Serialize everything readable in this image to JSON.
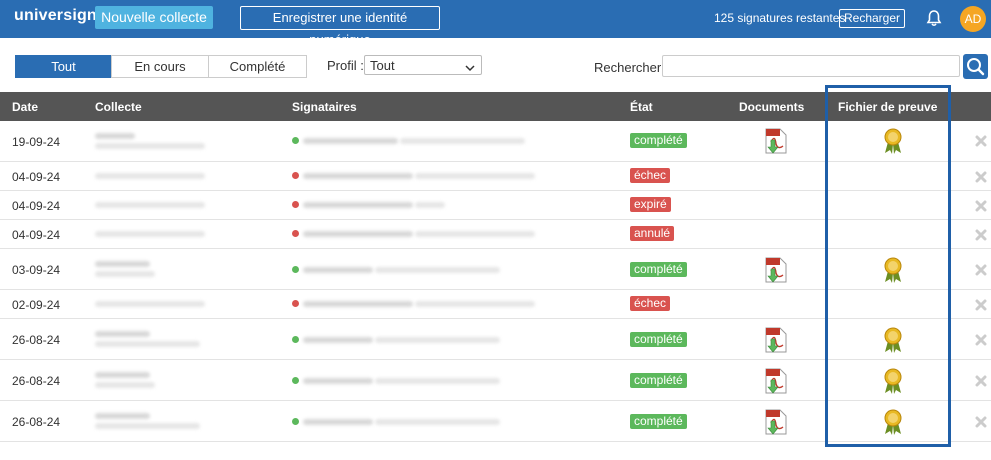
{
  "header": {
    "logo_text": "universign",
    "new_collect_label": "Nouvelle collecte",
    "register_id_label": "Enregistrer une identité numérique",
    "remaining_signatures": "125 signatures restantes",
    "recharge_label": "Recharger",
    "avatar_initials": "AD"
  },
  "filters": {
    "tabs": [
      "Tout",
      "En cours",
      "Complété"
    ],
    "active_tab": "Tout",
    "profil_label": "Profil :",
    "profil_value": "Tout",
    "search_label": "Rechercher :",
    "search_value": ""
  },
  "table": {
    "columns": [
      "Date",
      "Collecte",
      "Signataires",
      "État",
      "Documents",
      "Fichier de preuve"
    ],
    "rows": [
      {
        "date": "19-09-24",
        "state": "complété",
        "signer_status": "ok",
        "document": true,
        "proof": true
      },
      {
        "date": "04-09-24",
        "state": "échec",
        "signer_status": "err",
        "document": false,
        "proof": false
      },
      {
        "date": "04-09-24",
        "state": "expiré",
        "signer_status": "err",
        "document": false,
        "proof": false
      },
      {
        "date": "04-09-24",
        "state": "annulé",
        "signer_status": "err",
        "document": false,
        "proof": false
      },
      {
        "date": "03-09-24",
        "state": "complété",
        "signer_status": "ok",
        "document": true,
        "proof": true
      },
      {
        "date": "02-09-24",
        "state": "échec",
        "signer_status": "err",
        "document": false,
        "proof": false
      },
      {
        "date": "26-08-24",
        "state": "complété",
        "signer_status": "ok",
        "document": true,
        "proof": true
      },
      {
        "date": "26-08-24",
        "state": "complété",
        "signer_status": "ok",
        "document": true,
        "proof": true
      },
      {
        "date": "26-08-24",
        "state": "complété",
        "signer_status": "ok",
        "document": true,
        "proof": true
      }
    ]
  },
  "colors": {
    "header_bg": "#2a6db3",
    "accent_button": "#4fb3e0",
    "ok": "#5cb85c",
    "error": "#d9534f",
    "highlight_border": "#1f5fa8"
  },
  "icons": {
    "documents": "pdf-download-icon",
    "proof": "award-ribbon-icon",
    "delete": "delete-x-icon",
    "notifications": "bell-icon",
    "search": "search-icon"
  }
}
